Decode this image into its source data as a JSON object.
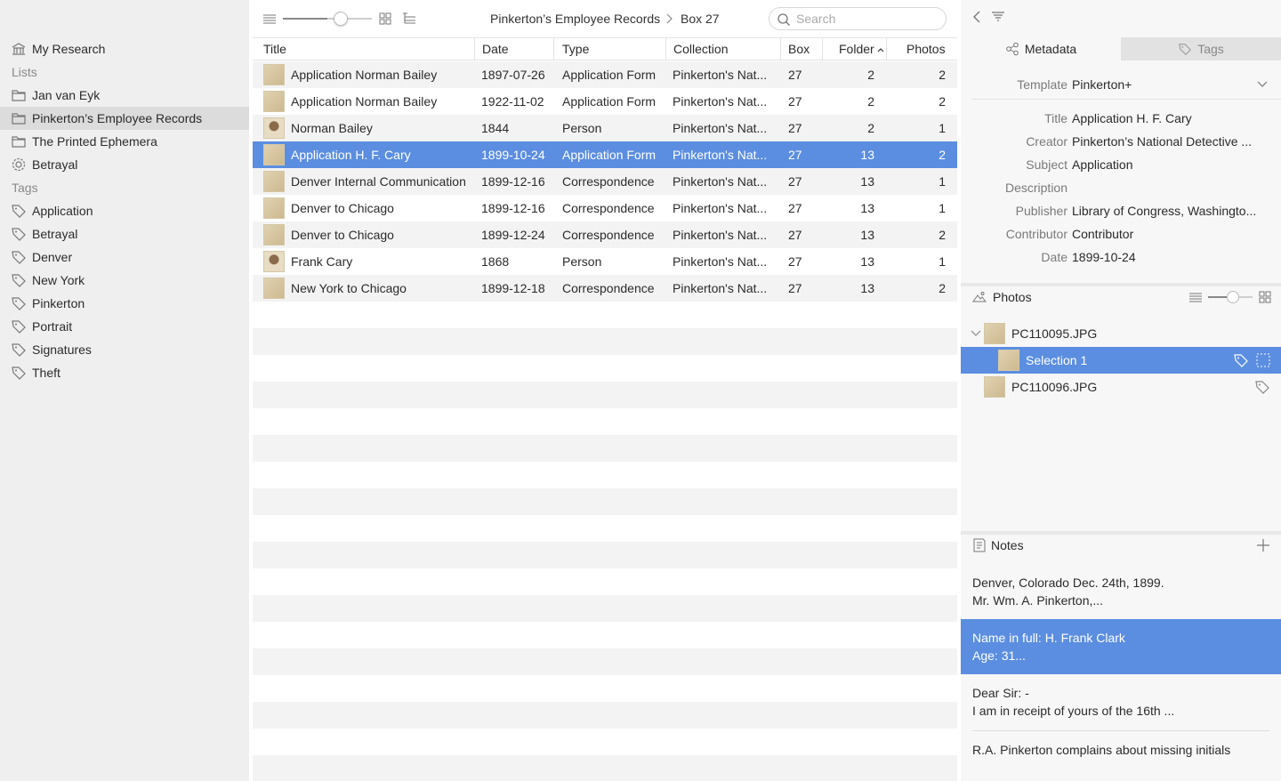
{
  "sidebar": {
    "my_research": "My Research",
    "lists_heading": "Lists",
    "lists": [
      "Jan van Eyk",
      "Pinkerton’s Employee Records",
      "The Printed Ephemera",
      "Betrayal"
    ],
    "tags_heading": "Tags",
    "tags": [
      "Application",
      "Betrayal",
      "Denver",
      "New York",
      "Pinkerton",
      "Portrait",
      "Signatures",
      "Theft"
    ]
  },
  "toolbar": {
    "breadcrumb_1": "Pinkerton’s Employee Records",
    "breadcrumb_2": "Box 27",
    "search_placeholder": "Search",
    "zoom_level": 0.5
  },
  "table": {
    "columns": [
      "Title",
      "Date",
      "Type",
      "Collection",
      "Box",
      "Folder",
      "Photos"
    ],
    "rows": [
      {
        "title": "Application Norman Bailey",
        "date": "1897-07-26",
        "type": "Application Form",
        "collection": "Pinkerton's Nat...",
        "box": "27",
        "folder": "2",
        "photos": "2"
      },
      {
        "title": "Application Norman Bailey",
        "date": "1922-11-02",
        "type": "Application Form",
        "collection": "Pinkerton's Nat...",
        "box": "27",
        "folder": "2",
        "photos": "2"
      },
      {
        "title": "Norman Bailey",
        "date": "1844",
        "type": "Person",
        "collection": "Pinkerton's Nat...",
        "box": "27",
        "folder": "2",
        "photos": "1"
      },
      {
        "title": "Application H. F. Cary",
        "date": "1899-10-24",
        "type": "Application Form",
        "collection": "Pinkerton's Nat...",
        "box": "27",
        "folder": "13",
        "photos": "2"
      },
      {
        "title": "Denver Internal Communication",
        "date": "1899-12-16",
        "type": "Correspondence",
        "collection": "Pinkerton's Nat...",
        "box": "27",
        "folder": "13",
        "photos": "1"
      },
      {
        "title": "Denver to Chicago",
        "date": "1899-12-16",
        "type": "Correspondence",
        "collection": "Pinkerton's Nat...",
        "box": "27",
        "folder": "13",
        "photos": "1"
      },
      {
        "title": "Denver to Chicago",
        "date": "1899-12-24",
        "type": "Correspondence",
        "collection": "Pinkerton's Nat...",
        "box": "27",
        "folder": "13",
        "photos": "2"
      },
      {
        "title": "Frank Cary",
        "date": "1868",
        "type": "Person",
        "collection": "Pinkerton's Nat...",
        "box": "27",
        "folder": "13",
        "photos": "1"
      },
      {
        "title": "New York to Chicago",
        "date": "1899-12-18",
        "type": "Correspondence",
        "collection": "Pinkerton's Nat...",
        "box": "27",
        "folder": "13",
        "photos": "2"
      }
    ]
  },
  "panel": {
    "tab_metadata": "Metadata",
    "tab_tags": "Tags",
    "template_label": "Template",
    "template_value": "Pinkerton+",
    "fields": [
      {
        "label": "Title",
        "value": "Application H. F. Cary"
      },
      {
        "label": "Creator",
        "value": "Pinkerton’s National Detective ..."
      },
      {
        "label": "Subject",
        "value": "Application"
      },
      {
        "label": "Description",
        "value": ""
      },
      {
        "label": "Publisher",
        "value": "Library of Congress, Washingto..."
      },
      {
        "label": "Contributor",
        "value": "Contributor"
      },
      {
        "label": "Date",
        "value": "1899-10-24"
      }
    ],
    "photos_heading": "Photos",
    "photos": [
      "PC110095.JPG",
      "Selection 1",
      "PC110096.JPG"
    ],
    "notes_heading": "Notes",
    "notes": [
      {
        "line1": "Denver, Colorado Dec. 24th, 1899.",
        "line2": "Mr. Wm. A. Pinkerton,..."
      },
      {
        "line1": "Name in full: H. Frank Clark",
        "line2": "Age: 31..."
      },
      {
        "line1": "Dear Sir: -",
        "line2": "I am in receipt of yours of the 16th ..."
      },
      {
        "line1": "R.A. Pinkerton complains about missing initials",
        "line2": ""
      }
    ]
  }
}
